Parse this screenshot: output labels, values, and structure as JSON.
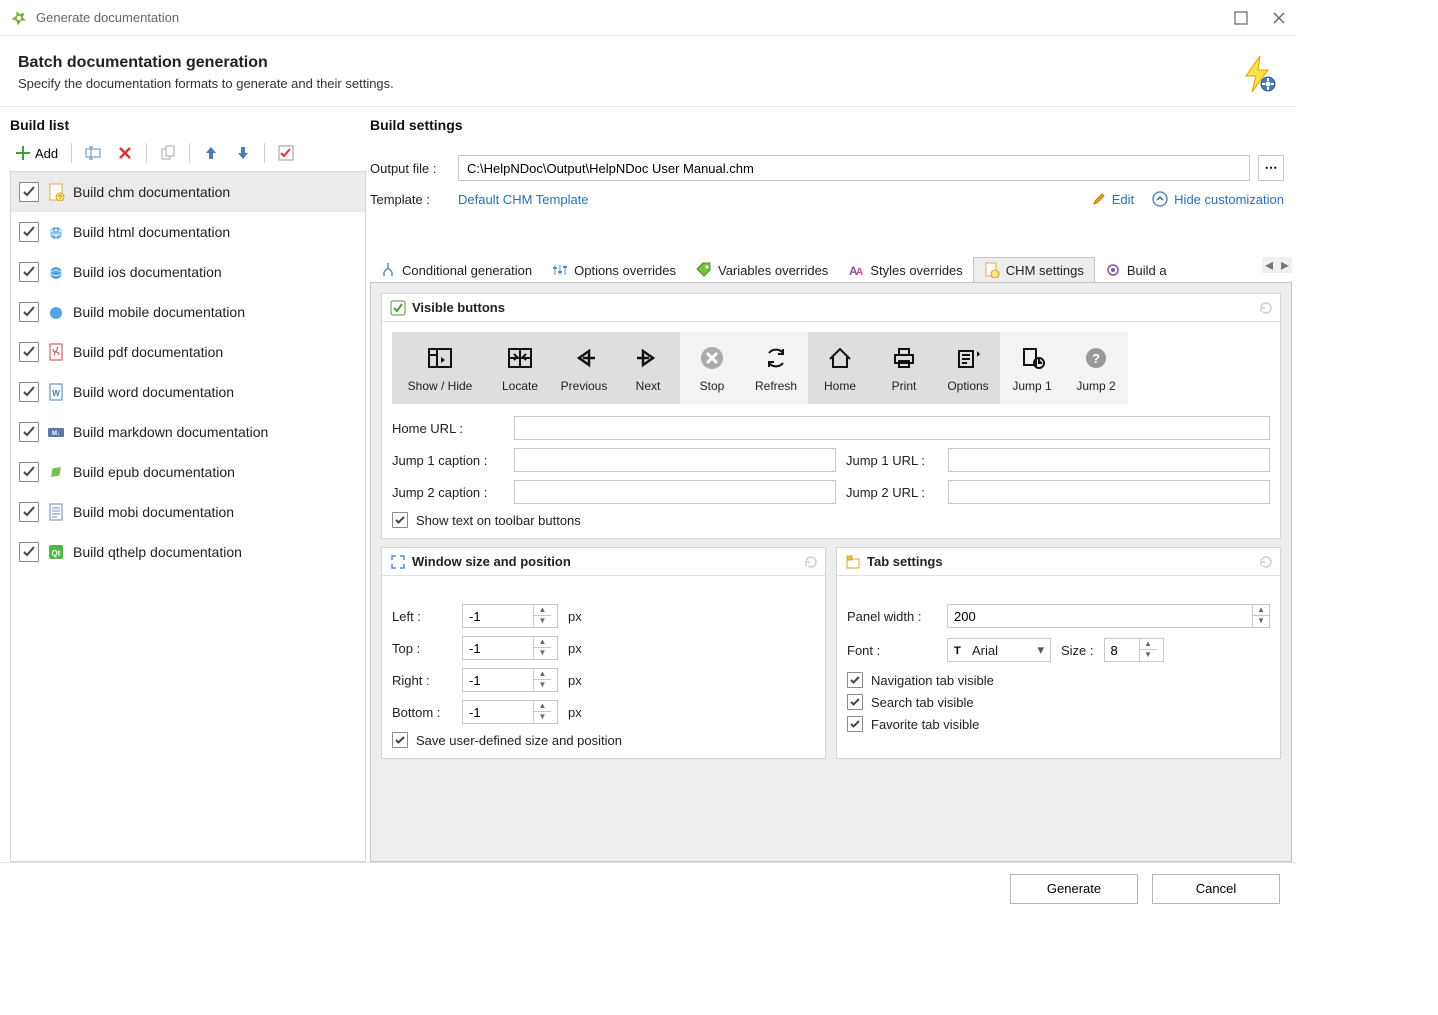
{
  "window": {
    "title": "Generate documentation"
  },
  "header": {
    "title": "Batch documentation generation",
    "subtitle": "Specify the documentation formats to generate and their settings."
  },
  "left": {
    "title": "Build list",
    "add_label": "Add",
    "items": [
      {
        "label": "Build chm documentation"
      },
      {
        "label": "Build html documentation"
      },
      {
        "label": "Build ios documentation"
      },
      {
        "label": "Build mobile documentation"
      },
      {
        "label": "Build pdf documentation"
      },
      {
        "label": "Build word documentation"
      },
      {
        "label": "Build markdown documentation"
      },
      {
        "label": "Build epub documentation"
      },
      {
        "label": "Build mobi documentation"
      },
      {
        "label": "Build qthelp documentation"
      }
    ]
  },
  "right": {
    "title": "Build settings",
    "output_label": "Output file :",
    "output_value": "C:\\HelpNDoc\\Output\\HelpNDoc User Manual.chm",
    "template_label": "Template :",
    "template_link": "Default CHM Template",
    "edit_link": "Edit",
    "hide_link": "Hide customization"
  },
  "tabs": {
    "t0": "Conditional generation",
    "t1": "Options overrides",
    "t2": "Variables overrides",
    "t3": "Styles overrides",
    "t4": "CHM settings",
    "t5": "Build a"
  },
  "visible_buttons": {
    "title": "Visible buttons",
    "show_hide": "Show / Hide",
    "locate": "Locate",
    "previous": "Previous",
    "next": "Next",
    "stop": "Stop",
    "refresh": "Refresh",
    "home": "Home",
    "print": "Print",
    "options": "Options",
    "jump1": "Jump 1",
    "jump2": "Jump 2",
    "home_url_label": "Home URL :",
    "jump1_cap_label": "Jump 1 caption :",
    "jump1_url_label": "Jump 1 URL :",
    "jump2_cap_label": "Jump 2 caption :",
    "jump2_url_label": "Jump 2 URL :",
    "show_text_label": "Show text on toolbar buttons"
  },
  "window_group": {
    "title": "Window size and position",
    "left": "Left :",
    "top": "Top :",
    "right": "Right :",
    "bottom": "Bottom :",
    "unit": "px",
    "vals": {
      "left": "-1",
      "top": "-1",
      "right": "-1",
      "bottom": "-1"
    },
    "save_label": "Save user-defined size and position"
  },
  "tab_group": {
    "title": "Tab settings",
    "panel_width_label": "Panel width :",
    "panel_width": "200",
    "font_label": "Font :",
    "font": "Arial",
    "size_label": "Size :",
    "size": "8",
    "nav_label": "Navigation tab visible",
    "search_label": "Search tab visible",
    "fav_label": "Favorite tab visible"
  },
  "footer": {
    "generate": "Generate",
    "cancel": "Cancel"
  }
}
